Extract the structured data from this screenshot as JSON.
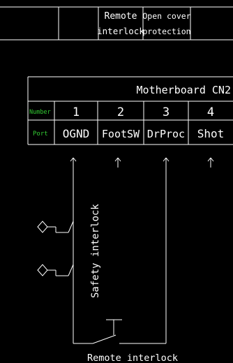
{
  "top_table": {
    "col1": [
      "Remote",
      "interlock"
    ],
    "col2": [
      "Open cover",
      "protection"
    ]
  },
  "connector": {
    "title": "Motherboard CN2",
    "row_number_label": "Number",
    "row_port_label": "Port",
    "pins": [
      {
        "number": "1",
        "port": "OGND"
      },
      {
        "number": "2",
        "port": "FootSW"
      },
      {
        "number": "3",
        "port": "DrProc"
      },
      {
        "number": "4",
        "port": "Shot"
      }
    ]
  },
  "labels": {
    "safety_interlock": "Safety interlock",
    "remote_interlock": "Remote interlock"
  },
  "colors": {
    "background": "#000000",
    "lines": "#ffffff",
    "row_labels": "#33cc33"
  }
}
